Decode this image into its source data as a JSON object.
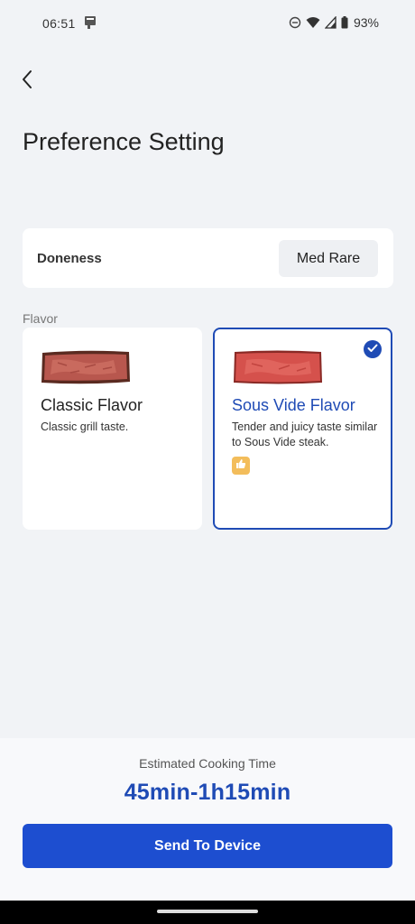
{
  "status_bar": {
    "time": "06:51",
    "battery": "93%"
  },
  "header": {
    "title": "Preference Setting"
  },
  "doneness": {
    "label": "Doneness",
    "value": "Med Rare"
  },
  "flavor": {
    "section_label": "Flavor",
    "options": [
      {
        "title": "Classic Flavor",
        "description": "Classic grill taste.",
        "selected": false
      },
      {
        "title": "Sous Vide Flavor",
        "description": "Tender and juicy taste similar to Sous Vide steak.",
        "selected": true
      }
    ]
  },
  "footer": {
    "estimate_label": "Estimated Cooking Time",
    "estimate_value": "45min-1h15min",
    "send_label": "Send To Device"
  },
  "colors": {
    "accent": "#1f4bb5",
    "button": "#1d4ed0",
    "background": "#f1f3f6",
    "thumb_badge": "#f3bd5b"
  },
  "icons": [
    "notification-icon",
    "dnd-icon",
    "wifi-icon",
    "signal-icon",
    "battery-icon",
    "back-arrow-icon",
    "check-icon",
    "thumbs-up-icon"
  ]
}
